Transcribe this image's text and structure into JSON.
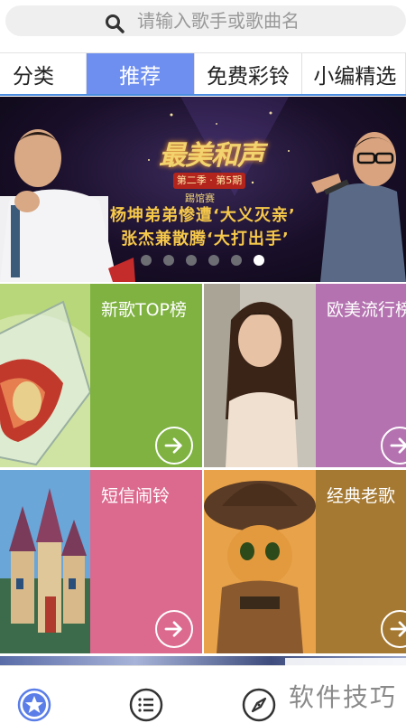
{
  "search": {
    "placeholder": "请输入歌手或歌曲名",
    "icon": "search-icon"
  },
  "tabs": [
    {
      "label": "分类",
      "active": false
    },
    {
      "label": "推荐",
      "active": true
    },
    {
      "label": "免费彩铃",
      "active": false
    },
    {
      "label": "小编精选",
      "active": false
    }
  ],
  "banner": {
    "show_title": "最美和声",
    "season_badge": "第二季 · 第5期",
    "round": "踢馆赛",
    "headline_1": "杨坤弟弟惨遭‘大义灭亲’",
    "headline_2": "张杰兼散腾‘大打出手’",
    "slide_count": 6,
    "active_slide": 6
  },
  "tiles": [
    {
      "label": "新歌TOP榜",
      "color": "#7fb241",
      "arrow_icon": "arrow-right-icon"
    },
    {
      "label": "欧美流行榜",
      "color": "#b473b0",
      "arrow_icon": "arrow-right-icon"
    },
    {
      "label": "短信闹铃",
      "color": "#dc6a8f",
      "arrow_icon": "arrow-right-icon"
    },
    {
      "label": "经典老歌",
      "color": "#a57932",
      "arrow_icon": "arrow-right-icon"
    }
  ],
  "bottom_nav": [
    {
      "icon": "star-icon",
      "active": true
    },
    {
      "icon": "list-icon",
      "active": false
    },
    {
      "icon": "compass-icon",
      "active": false
    }
  ],
  "watermark": "软件技巧",
  "colors": {
    "accent": "#6f8ff0",
    "tab_underline": "#4d8de0",
    "nav_active": "#5a7de8"
  }
}
